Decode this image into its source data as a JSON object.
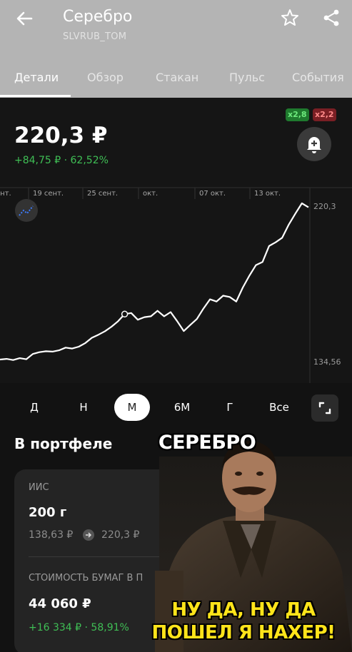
{
  "header": {
    "title": "Серебро",
    "ticker": "SLVRUB_TOM"
  },
  "tabs": [
    {
      "label": "Детали",
      "active": true
    },
    {
      "label": "Обзор"
    },
    {
      "label": "Стакан"
    },
    {
      "label": "Пульс"
    },
    {
      "label": "События"
    }
  ],
  "quote": {
    "price": "220,3 ₽",
    "change": "+84,75 ₽ · 62,52%",
    "leverage_long": "x2,8",
    "leverage_short": "x2,2"
  },
  "chart_data": {
    "type": "line",
    "x_ticks": [
      "ент.",
      "19 сент.",
      "25 сент.",
      "окт.",
      "07 окт.",
      "13 окт."
    ],
    "y_high_label": "220,3",
    "y_low_label": "134,56",
    "ylim": [
      134.56,
      220.3
    ],
    "values": [
      134.56,
      134.9,
      134.3,
      135.3,
      134.7,
      137.6,
      138.6,
      139.1,
      138.9,
      139.6,
      141.1,
      140.6,
      141.6,
      143.6,
      146.5,
      148.2,
      150.1,
      152.6,
      155.6,
      159.5,
      160.1,
      156.4,
      157.8,
      158.3,
      161.3,
      158.3,
      160.6,
      155.6,
      150.2,
      153.6,
      156.8,
      162.5,
      167.6,
      166.4,
      169.6,
      168.9,
      166.4,
      174.1,
      180.6,
      186.4,
      188.1,
      196.9,
      198.9,
      201.4,
      208.6,
      214.6,
      220.3,
      218.1
    ],
    "accent_color": "#ffffff"
  },
  "periods": [
    {
      "label": "Д"
    },
    {
      "label": "Н"
    },
    {
      "label": "М",
      "active": true
    },
    {
      "label": "6М"
    },
    {
      "label": "Г"
    },
    {
      "label": "Все"
    }
  ],
  "portfolio": {
    "title": "В портфеле",
    "account_label": "ИИС",
    "quantity": "200 г",
    "avg_price": "138,63 ₽",
    "current_price": "220,3 ₽",
    "value_label": "СТОИМОСТЬ БУМАГ В П",
    "value": "44 060 ₽",
    "gain": "+16 334 ₽ · 58,91%"
  },
  "meme": {
    "top_text": "СЕРЕБРО",
    "bottom_line1": "НУ ДА, НУ ДА",
    "bottom_line2": "ПОШЕЛ Я НАХЕР!"
  }
}
